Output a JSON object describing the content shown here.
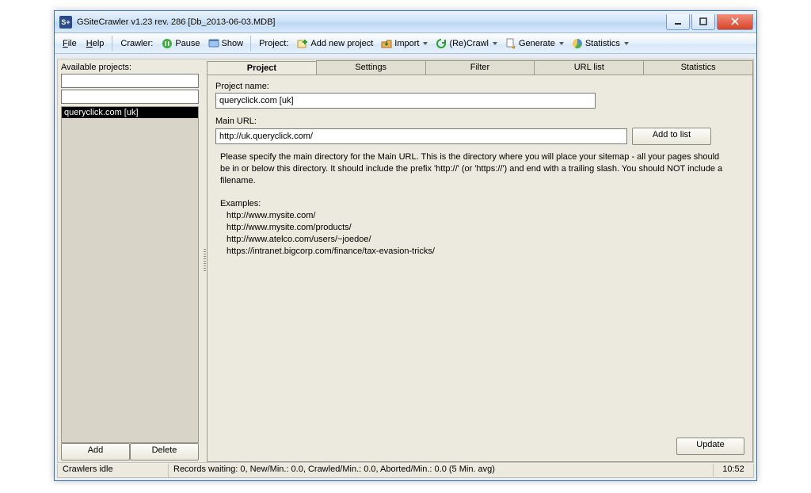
{
  "window": {
    "title": "GSiteCrawler v1.23 rev. 286 [Db_2013-06-03.MDB]"
  },
  "menu": {
    "file": "File",
    "help": "Help"
  },
  "toolbar": {
    "crawler_label": "Crawler:",
    "pause": "Pause",
    "show": "Show",
    "project_label": "Project:",
    "add_project": "Add new project",
    "import": "Import",
    "recrawl": "(Re)Crawl",
    "generate": "Generate",
    "statistics": "Statistics"
  },
  "left": {
    "label": "Available projects:",
    "input1": "",
    "input2": "",
    "selected": "queryclick.com [uk]",
    "add": "Add",
    "delete": "Delete"
  },
  "tabs": [
    "Project",
    "Settings",
    "Filter",
    "URL list",
    "Statistics"
  ],
  "project_tab": {
    "name_label": "Project name:",
    "name_value": "queryclick.com [uk]",
    "url_label": "Main URL:",
    "url_value": "http://uk.queryclick.com/",
    "add_to_list": "Add to list",
    "help_p1": "Please specify the main directory for the Main URL. This is the directory where you will place your sitemap - all your pages should be in or below this directory. It should include the prefix 'http://' (or 'https://') and end with a trailing slash.  You should NOT include a filename.",
    "examples_label": "Examples:",
    "examples": [
      "http://www.mysite.com/",
      "http://www.mysite.com/products/",
      "http://www.atelco.com/users/~joedoe/",
      "https://intranet.bigcorp.com/finance/tax-evasion-tricks/"
    ],
    "update": "Update"
  },
  "status": {
    "crawlers": "Crawlers idle",
    "records": "Records waiting: 0, New/Min.: 0.0, Crawled/Min.: 0.0, Aborted/Min.: 0.0 (5 Min. avg)",
    "time": "10:52"
  }
}
